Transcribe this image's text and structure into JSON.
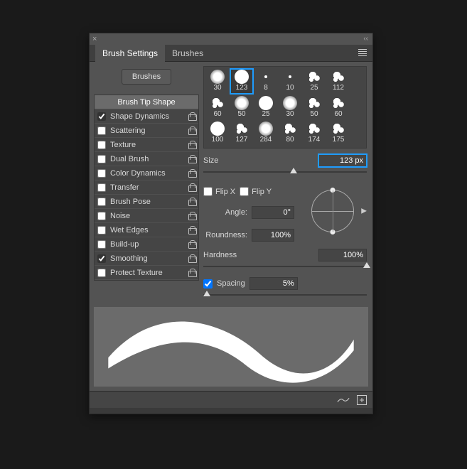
{
  "tabs": {
    "settings": "Brush Settings",
    "brushes": "Brushes"
  },
  "brushes_button": "Brushes",
  "options": {
    "header": "Brush Tip Shape",
    "items": [
      {
        "label": "Shape Dynamics",
        "checked": true
      },
      {
        "label": "Scattering",
        "checked": false
      },
      {
        "label": "Texture",
        "checked": false
      },
      {
        "label": "Dual Brush",
        "checked": false
      },
      {
        "label": "Color Dynamics",
        "checked": false
      },
      {
        "label": "Transfer",
        "checked": false
      },
      {
        "label": "Brush Pose",
        "checked": false
      },
      {
        "label": "Noise",
        "checked": false
      },
      {
        "label": "Wet Edges",
        "checked": false
      },
      {
        "label": "Build-up",
        "checked": false
      },
      {
        "label": "Smoothing",
        "checked": true
      },
      {
        "label": "Protect Texture",
        "checked": false
      }
    ]
  },
  "thumbs": [
    {
      "n": "30",
      "style": "soft"
    },
    {
      "n": "123",
      "style": "hard",
      "selected": true
    },
    {
      "n": "8",
      "style": "tiny"
    },
    {
      "n": "10",
      "style": "tiny"
    },
    {
      "n": "25",
      "style": "splat"
    },
    {
      "n": "112",
      "style": "splat"
    },
    {
      "n": "60",
      "style": "splat"
    },
    {
      "n": "50",
      "style": "soft"
    },
    {
      "n": "25",
      "style": "hard"
    },
    {
      "n": "30",
      "style": "soft"
    },
    {
      "n": "50",
      "style": "splat"
    },
    {
      "n": "60",
      "style": "splat"
    },
    {
      "n": "100",
      "style": "hard"
    },
    {
      "n": "127",
      "style": "splat"
    },
    {
      "n": "284",
      "style": "soft"
    },
    {
      "n": "80",
      "style": "splat"
    },
    {
      "n": "174",
      "style": "splat"
    },
    {
      "n": "175",
      "style": "splat"
    }
  ],
  "size": {
    "label": "Size",
    "value": "123 px",
    "slider_pct": 55
  },
  "flip": {
    "x_label": "Flip X",
    "y_label": "Flip Y",
    "x": false,
    "y": false
  },
  "angle": {
    "label": "Angle:",
    "value": "0°"
  },
  "roundness": {
    "label": "Roundness:",
    "value": "100%"
  },
  "hardness": {
    "label": "Hardness",
    "value": "100%",
    "slider_pct": 100
  },
  "spacing": {
    "label": "Spacing",
    "value": "5%",
    "checked": true,
    "slider_pct": 2
  }
}
